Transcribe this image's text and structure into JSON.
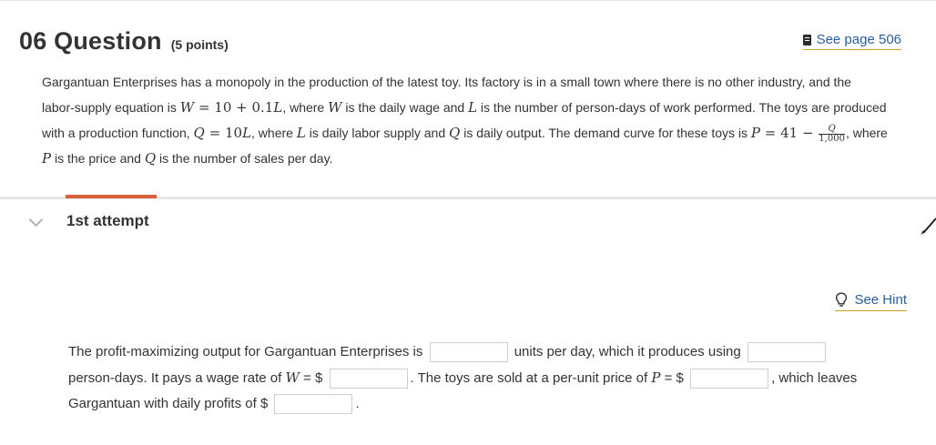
{
  "header": {
    "number": "06",
    "title": "Question",
    "points": "(5 points)",
    "see_page": "See page 506"
  },
  "question": {
    "line1": "Gargantuan Enterprises has a monopoly in the production of the latest toy. Its factory is in a small town where there is no other industry, and the",
    "l2_a": "labor-supply equation is ",
    "eq_wage_var": "W",
    "eq_wage_rest": " = 10 + 0.1",
    "eq_wage_L": "L",
    "l2_b": ", where ",
    "l2_W": "W",
    "l2_c": " is the daily wage and ",
    "l2_L": "L",
    "l2_d": " is the number of person-days of work performed. The toys are produced",
    "l3_a": "with a production function, ",
    "l3_Q": "Q",
    "l3_eq": " = 10",
    "l3_L": "L",
    "l3_b": ", where ",
    "l3_L2": "L",
    "l3_c": " is daily labor supply and ",
    "l3_Q2": "Q",
    "l3_d": " is daily output. The demand curve for these toys is ",
    "l3_P": "P",
    "l3_eq2": " = 41 − ",
    "frac_num": "Q",
    "frac_den": "1,000",
    "l3_e": ", where",
    "l4_P": "P",
    "l4_a": " is the price and ",
    "l4_Q": "Q",
    "l4_b": " is the number of sales per day."
  },
  "attempt": {
    "label": "1st attempt",
    "see_hint": "See Hint"
  },
  "answer": {
    "a1": "The profit-maximizing output for Gargantuan Enterprises is",
    "a2": "units per day, which it produces using",
    "a3": "person-days. It pays a wage rate of ",
    "a3_W": "W",
    "a3_eq": " = $",
    "a4": ". The toys are sold at a per-unit price of ",
    "a4_P": "P",
    "a4_eq": " = $",
    "a5": ", which leaves",
    "a6": "Gargantuan with daily profits of $",
    "a7": "."
  },
  "colors": {
    "accent": "#d9603b",
    "link": "#2a5f9e",
    "underline": "#c9a227"
  },
  "icons": [
    "book-icon",
    "chevron-down-icon",
    "edit-pencil-icon",
    "lightbulb-icon"
  ]
}
